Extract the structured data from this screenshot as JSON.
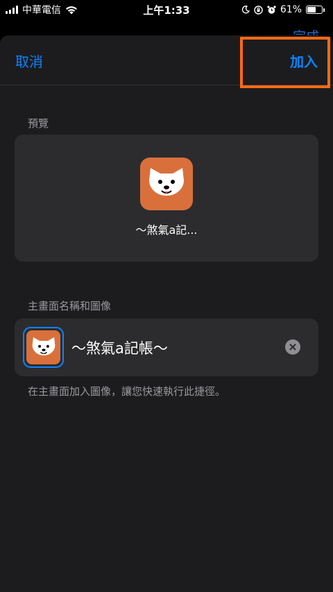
{
  "status_bar": {
    "carrier": "中華電信",
    "time": "上午1:33",
    "battery_percent": "61%",
    "battery_level": 0.61
  },
  "background": {
    "done_label": "完成"
  },
  "nav": {
    "cancel_label": "取消",
    "add_label": "加入"
  },
  "preview": {
    "section_label": "預覽",
    "app_name": "～煞氣a記..."
  },
  "home_screen": {
    "section_label": "主畫面名稱和圖像",
    "name_value": "～煞氣a記帳～",
    "footer_note": "在主畫面加入圖像，讓您快速執行此捷徑。"
  },
  "colors": {
    "accent": "#0a84ff",
    "icon_background": "#d9703c",
    "highlight": "#ff6a13"
  }
}
